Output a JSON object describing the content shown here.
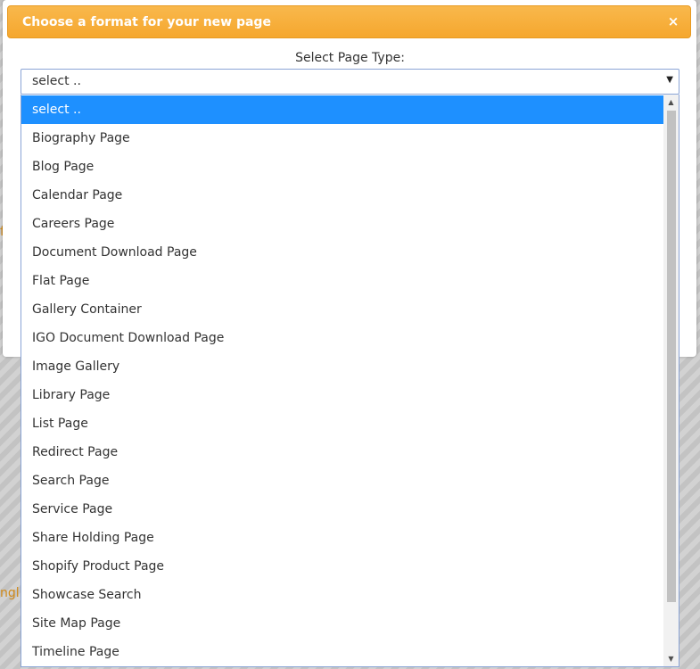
{
  "background": {
    "fragment_1": "f",
    "fragment_2": "nglis"
  },
  "dialog": {
    "title": "Choose a format for your new page",
    "close_glyph": "×"
  },
  "form": {
    "label": "Select Page Type:",
    "selected_value": "select ..",
    "arrow_glyph": "▼"
  },
  "dropdown": {
    "options": [
      "select ..",
      "Biography Page",
      "Blog Page",
      "Calendar Page",
      "Careers Page",
      "Document Download Page",
      "Flat Page",
      "Gallery Container",
      "IGO Document Download Page",
      "Image Gallery",
      "Library Page",
      "List Page",
      "Redirect Page",
      "Search Page",
      "Service Page",
      "Share Holding Page",
      "Shopify Product Page",
      "Showcase Search",
      "Site Map Page",
      "Timeline Page"
    ],
    "highlighted_index": 0,
    "scroll_up_glyph": "▲",
    "scroll_down_glyph": "▼"
  },
  "colors": {
    "header_orange": "#f5a72e",
    "selection_blue": "#1e90ff",
    "background_link_orange": "#d08a1a"
  },
  "icons": {
    "close": "close-icon",
    "dropdown": "chevron-down-icon"
  }
}
